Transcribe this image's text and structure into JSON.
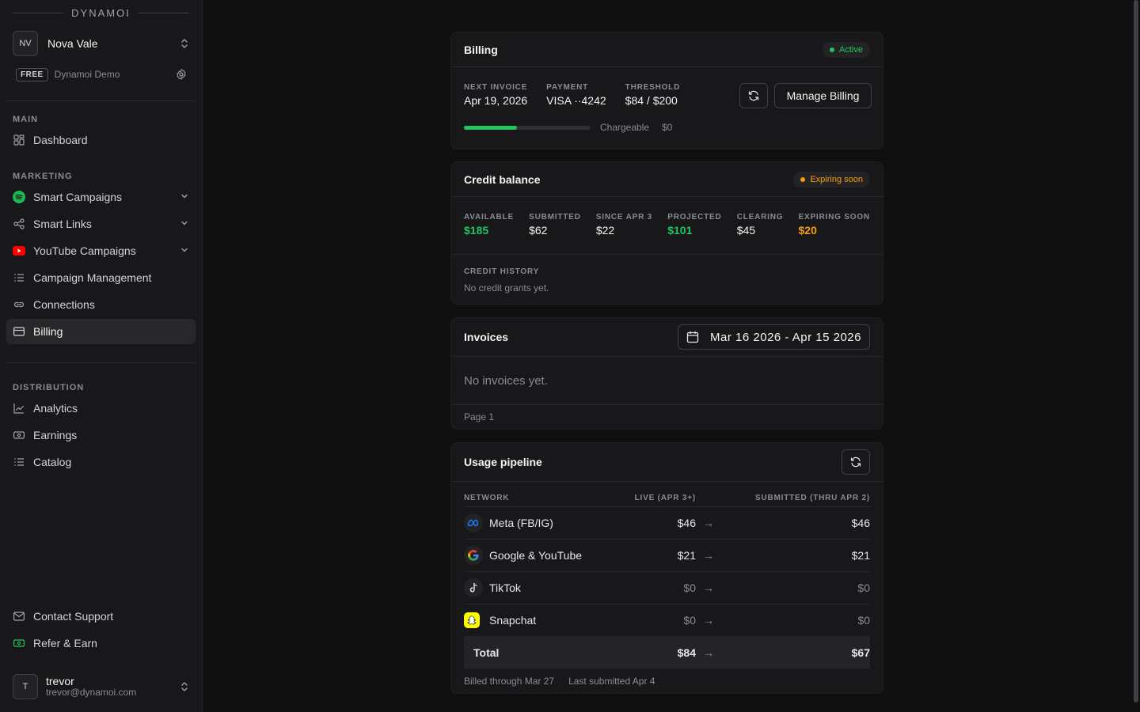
{
  "sidebar": {
    "brand": "DYNAMOI",
    "workspace": {
      "initials": "NV",
      "name": "Nova Vale"
    },
    "plan": {
      "badge": "FREE",
      "name": "Dynamoi Demo"
    },
    "sections": {
      "main": "MAIN",
      "marketing": "MARKETING",
      "distribution": "DISTRIBUTION"
    },
    "items": {
      "dashboard": "Dashboard",
      "smart_campaigns": "Smart Campaigns",
      "smart_links": "Smart Links",
      "youtube_campaigns": "YouTube Campaigns",
      "campaign_management": "Campaign Management",
      "connections": "Connections",
      "billing": "Billing",
      "analytics": "Analytics",
      "earnings": "Earnings",
      "catalog": "Catalog",
      "contact_support": "Contact Support",
      "refer_earn": "Refer & Earn"
    },
    "user": {
      "initial": "T",
      "name": "trevor",
      "email": "trevor@dynamoi.com"
    }
  },
  "billing": {
    "title": "Billing",
    "status": "Active",
    "next_invoice_label": "NEXT INVOICE",
    "next_invoice": "Apr 19, 2026",
    "payment_label": "PAYMENT",
    "payment": "VISA ··4242",
    "threshold_label": "THRESHOLD",
    "threshold": "$84 / $200",
    "threshold_progress": 0.42,
    "chargeable_label": "Chargeable",
    "chargeable": "$0",
    "manage_label": "Manage Billing"
  },
  "credit": {
    "title": "Credit balance",
    "status": "Expiring soon",
    "stats": [
      {
        "label": "AVAILABLE",
        "value": "$185",
        "color": "#22c55e"
      },
      {
        "label": "SUBMITTED",
        "value": "$62",
        "color": "#f4f4f5"
      },
      {
        "label": "SINCE APR 3",
        "value": "$22",
        "color": "#f4f4f5"
      },
      {
        "label": "PROJECTED",
        "value": "$101",
        "color": "#22c55e"
      },
      {
        "label": "CLEARING",
        "value": "$45",
        "color": "#f4f4f5"
      },
      {
        "label": "EXPIRING SOON",
        "value": "$20",
        "color": "#f59e0b"
      }
    ],
    "history_label": "CREDIT HISTORY",
    "history_empty": "No credit grants yet."
  },
  "invoices": {
    "title": "Invoices",
    "date_range": "Mar 16 2026 - Apr 15 2026",
    "empty": "No invoices yet.",
    "page": "Page 1"
  },
  "usage": {
    "title": "Usage pipeline",
    "columns": {
      "network": "NETWORK",
      "live": "LIVE (APR 3+)",
      "submitted": "SUBMITTED (THRU APR 2)"
    },
    "rows": [
      {
        "network": "Meta (FB/IG)",
        "live": "$46",
        "submitted": "$46",
        "icon": "meta-icon"
      },
      {
        "network": "Google & YouTube",
        "live": "$21",
        "submitted": "$21",
        "icon": "google-icon"
      },
      {
        "network": "TikTok",
        "live": "$0",
        "submitted": "$0",
        "icon": "tiktok-icon"
      },
      {
        "network": "Snapchat",
        "live": "$0",
        "submitted": "$0",
        "icon": "snapchat-icon"
      }
    ],
    "total": {
      "label": "Total",
      "live": "$84",
      "submitted": "$67"
    },
    "billed_through": "Billed through Mar 27",
    "last_submitted": "Last submitted Apr 4"
  },
  "colors": {
    "green": "#22c55e",
    "orange": "#f59e0b",
    "youtube_red": "#ff0000",
    "spotify_green": "#1db954"
  }
}
